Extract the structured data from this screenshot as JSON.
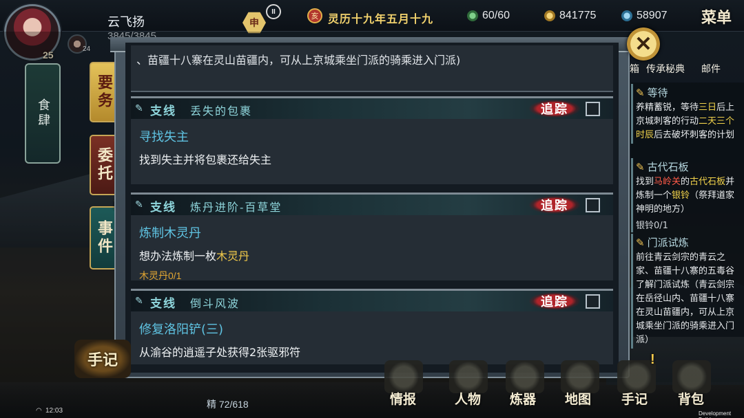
{
  "header": {
    "player_name": "云飞扬",
    "player_hp": "3845/3845",
    "player_level": "25",
    "pet_level": "24",
    "shen_badge": "申",
    "pause_label": "II",
    "calendar_badge": "亥",
    "date": "灵历十九年五月十九",
    "stamina": "60/60",
    "coins": "841775",
    "gems": "58907",
    "menu_label": "菜单"
  },
  "left": {
    "shisi_label": "食肆",
    "tab_yaowu": "要务",
    "tab_weituo": "委托",
    "tab_shijian": "事件"
  },
  "panel": {
    "continued_text": "、苗疆十八寨在灵山苗疆内，可从上京城乘坐门派的骑乘进入门派)",
    "quests": [
      {
        "type": "支线",
        "name": "丢失的包裹",
        "track": "追踪",
        "subtitle": "寻找失主",
        "desc": "找到失主并将包裹还给失主",
        "desc_highlight": "",
        "progress": ""
      },
      {
        "type": "支线",
        "name": "炼丹进阶-百草堂",
        "track": "追踪",
        "subtitle": "炼制木灵丹",
        "desc": "想办法炼制一枚",
        "desc_highlight": "木灵丹",
        "progress": "木灵丹0/1"
      },
      {
        "type": "支线",
        "name": "倒斗风波",
        "track": "追踪",
        "subtitle": "修复洛阳铲(三)",
        "desc": "从渝谷的逍遥子处获得2张驱邪符",
        "desc_highlight": "",
        "progress": ""
      }
    ]
  },
  "right": {
    "icon_labels": [
      "箱",
      "传承秘典",
      "邮件"
    ],
    "tracked": [
      {
        "title": "等待",
        "desc_a": "养精蓄锐，等待",
        "desc_a_hl": "三日",
        "desc_b": "后上京城刺客的行动",
        "desc_c_hl": "二天三个时辰",
        "desc_c": "后去破坏刺客的计划"
      },
      {
        "title": "古代石板",
        "desc_a": "找到",
        "desc_a_hl": "马岭关",
        "desc_b": "的",
        "desc_b_hl": "古代石板",
        "desc_c": "并炼制一个",
        "desc_c_hl": "银铃",
        "desc_d": "（祭拜道家神明的地方）",
        "progress": "银铃0/1"
      },
      {
        "title": "门派试炼",
        "desc": "前往青云剑宗的青云之家、苗疆十八寨的五毒谷了解门派试炼（青云剑宗在岳径山内、苗疆十八寨在灵山苗疆内，可从上京城乘坐门派的骑乘进入门派）"
      }
    ]
  },
  "bottom": {
    "shouji_big": "手记",
    "jing_label": "精",
    "jing_value": "72/618",
    "nav": [
      "情报",
      "人物",
      "炼器",
      "地图",
      "手记",
      "背包"
    ],
    "time": "12:03",
    "dev_build": "Development Build"
  },
  "colors": {
    "highlight_yellow": "#f1c94a",
    "highlight_red": "#ff5a48",
    "quest_cyan": "#8fd6dc",
    "track_red": "#b0242a"
  }
}
